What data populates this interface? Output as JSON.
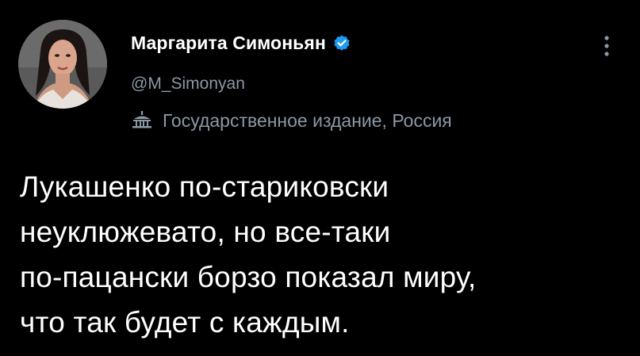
{
  "tweet": {
    "author": {
      "display_name": "Маргарита Симоньян",
      "handle": "@M_Simonyan",
      "verified_icon": "verified-badge-icon",
      "avatar": "profile-avatar"
    },
    "label": {
      "icon": "government-building-icon",
      "text": "Государственное издание, Россия"
    },
    "more_menu_icon": "more-vertical-icon",
    "text": "Лукашенко по-стариковски\nнеуклюжевато, но все-таки\nпо-пацански борзо показал миру,\nчто так будет с каждым."
  },
  "colors": {
    "background": "#000000",
    "primary_text": "#ffffff",
    "secondary_text": "#8b98a5",
    "verified_blue": "#1d9bf0"
  }
}
